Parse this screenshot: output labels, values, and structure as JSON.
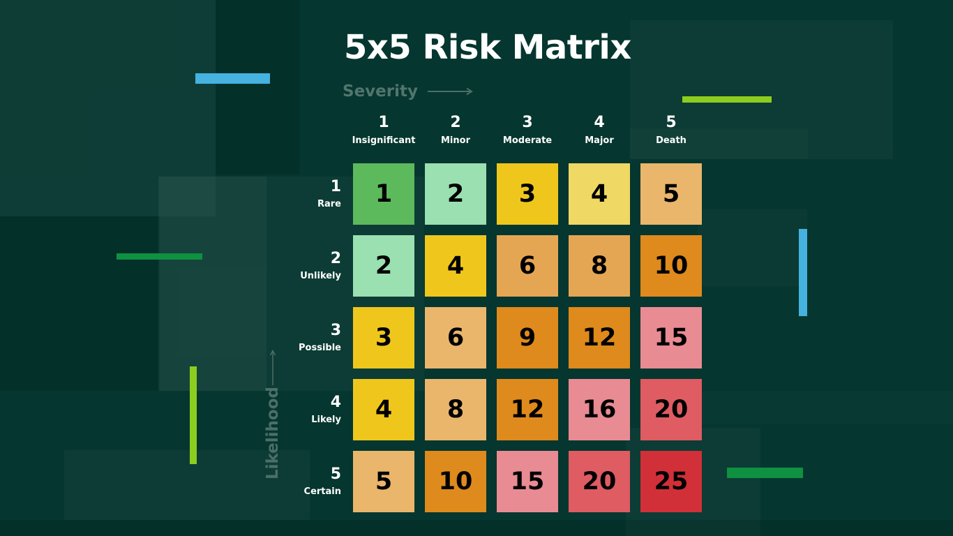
{
  "header": {
    "title": "5x5 Risk Matrix",
    "severity_axis_label": "Severity",
    "likelihood_axis_label": "Likelihood"
  },
  "theme": {
    "background": "#05362F",
    "title_color": "#FFFFFF",
    "axis_label_color": "#51756D",
    "header_text_color": "#FFFFFF",
    "cell_text_color": "#000000",
    "accent_blue": "#45B2E0",
    "accent_lime": "#8CCE1E",
    "accent_green": "#0E9140"
  },
  "chart_data": {
    "type": "heatmap",
    "title": "5x5 Risk Matrix",
    "xlabel": "Severity",
    "ylabel": "Likelihood",
    "columns": [
      {
        "num": "1",
        "label": "Insignificant"
      },
      {
        "num": "2",
        "label": "Minor"
      },
      {
        "num": "3",
        "label": "Moderate"
      },
      {
        "num": "4",
        "label": "Major"
      },
      {
        "num": "5",
        "label": "Death"
      }
    ],
    "rows": [
      {
        "num": "1",
        "label": "Rare"
      },
      {
        "num": "2",
        "label": "Unlikely"
      },
      {
        "num": "3",
        "label": "Possible"
      },
      {
        "num": "4",
        "label": "Likely"
      },
      {
        "num": "5",
        "label": "Certain"
      }
    ],
    "values": [
      [
        1,
        2,
        3,
        4,
        5
      ],
      [
        2,
        4,
        6,
        8,
        10
      ],
      [
        3,
        6,
        9,
        12,
        15
      ],
      [
        4,
        8,
        12,
        16,
        20
      ],
      [
        5,
        10,
        15,
        20,
        25
      ]
    ],
    "cell_colors": [
      [
        "#5CBA5C",
        "#9BE0B0",
        "#EFC71C",
        "#EFD964",
        "#E9B66C"
      ],
      [
        "#9BE0B0",
        "#EFC71C",
        "#E5A653",
        "#E5A653",
        "#DF8A1C"
      ],
      [
        "#EFC71C",
        "#E9B66C",
        "#DF8A1C",
        "#DF8A1C",
        "#E98B93"
      ],
      [
        "#EFC71C",
        "#E9B66C",
        "#DF8A1C",
        "#E98B93",
        "#DE5C62"
      ],
      [
        "#E9B66C",
        "#DF8A1C",
        "#E98B93",
        "#DE5C62",
        "#D13038"
      ]
    ]
  },
  "decor": {
    "blue_bar_top_left": "#45B2E0",
    "blue_bar_right": "#45B2E0",
    "green_bar_left": "#0E9140",
    "green_bar_bottom_right": "#0E9140",
    "lime_bar_top_right": "#8CCE1E",
    "lime_bar_vertical": "#8CCE1E"
  }
}
